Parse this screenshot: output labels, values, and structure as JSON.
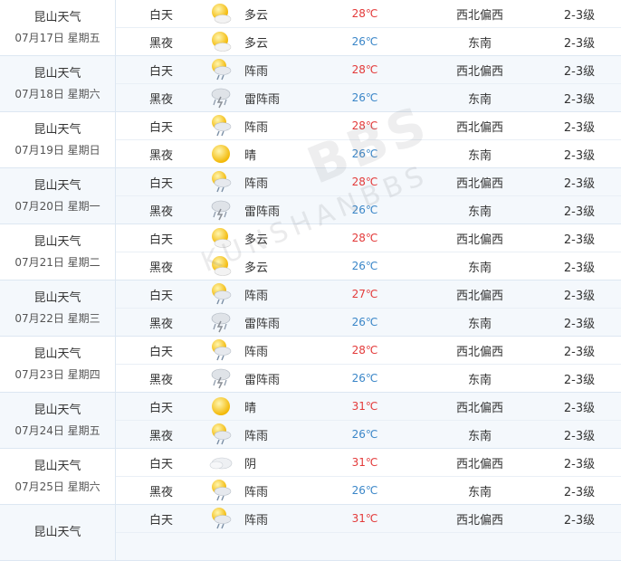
{
  "colors": {
    "hot": "#e33a3a",
    "mild": "#3a86c8",
    "row_alt": "#f4f8fc",
    "border": "#dde7f2"
  },
  "watermark": {
    "big": "BBS",
    "small": "KUNSHANBBS"
  },
  "days": [
    {
      "city": "昆山天气",
      "date": "07月17日 星期五",
      "day": {
        "period": "白天",
        "icon": "partly-cloudy-icon",
        "desc": "多云",
        "temp": "28℃",
        "wind": "西北偏西",
        "level": "2-3级"
      },
      "night": {
        "period": "黑夜",
        "icon": "partly-cloudy-icon",
        "desc": "多云",
        "temp": "26℃",
        "wind": "东南",
        "level": "2-3级"
      }
    },
    {
      "city": "昆山天气",
      "date": "07月18日 星期六",
      "day": {
        "period": "白天",
        "icon": "shower-icon",
        "desc": "阵雨",
        "temp": "28℃",
        "wind": "西北偏西",
        "level": "2-3级"
      },
      "night": {
        "period": "黑夜",
        "icon": "thunderstorm-icon",
        "desc": "雷阵雨",
        "temp": "26℃",
        "wind": "东南",
        "level": "2-3级"
      }
    },
    {
      "city": "昆山天气",
      "date": "07月19日 星期日",
      "day": {
        "period": "白天",
        "icon": "shower-icon",
        "desc": "阵雨",
        "temp": "28℃",
        "wind": "西北偏西",
        "level": "2-3级"
      },
      "night": {
        "period": "黑夜",
        "icon": "sun-icon",
        "desc": "晴",
        "temp": "26℃",
        "wind": "东南",
        "level": "2-3级"
      }
    },
    {
      "city": "昆山天气",
      "date": "07月20日 星期一",
      "day": {
        "period": "白天",
        "icon": "shower-icon",
        "desc": "阵雨",
        "temp": "28℃",
        "wind": "西北偏西",
        "level": "2-3级"
      },
      "night": {
        "period": "黑夜",
        "icon": "thunderstorm-icon",
        "desc": "雷阵雨",
        "temp": "26℃",
        "wind": "东南",
        "level": "2-3级"
      }
    },
    {
      "city": "昆山天气",
      "date": "07月21日 星期二",
      "day": {
        "period": "白天",
        "icon": "partly-cloudy-icon",
        "desc": "多云",
        "temp": "28℃",
        "wind": "西北偏西",
        "level": "2-3级"
      },
      "night": {
        "period": "黑夜",
        "icon": "partly-cloudy-icon",
        "desc": "多云",
        "temp": "26℃",
        "wind": "东南",
        "level": "2-3级"
      }
    },
    {
      "city": "昆山天气",
      "date": "07月22日 星期三",
      "day": {
        "period": "白天",
        "icon": "shower-icon",
        "desc": "阵雨",
        "temp": "27℃",
        "wind": "西北偏西",
        "level": "2-3级"
      },
      "night": {
        "period": "黑夜",
        "icon": "thunderstorm-icon",
        "desc": "雷阵雨",
        "temp": "26℃",
        "wind": "东南",
        "level": "2-3级"
      }
    },
    {
      "city": "昆山天气",
      "date": "07月23日 星期四",
      "day": {
        "period": "白天",
        "icon": "shower-icon",
        "desc": "阵雨",
        "temp": "28℃",
        "wind": "西北偏西",
        "level": "2-3级"
      },
      "night": {
        "period": "黑夜",
        "icon": "thunderstorm-icon",
        "desc": "雷阵雨",
        "temp": "26℃",
        "wind": "东南",
        "level": "2-3级"
      }
    },
    {
      "city": "昆山天气",
      "date": "07月24日 星期五",
      "day": {
        "period": "白天",
        "icon": "sun-icon",
        "desc": "晴",
        "temp": "31℃",
        "wind": "西北偏西",
        "level": "2-3级"
      },
      "night": {
        "period": "黑夜",
        "icon": "shower-icon",
        "desc": "阵雨",
        "temp": "26℃",
        "wind": "东南",
        "level": "2-3级"
      }
    },
    {
      "city": "昆山天气",
      "date": "07月25日 星期六",
      "day": {
        "period": "白天",
        "icon": "overcast-icon",
        "desc": "阴",
        "temp": "31℃",
        "wind": "西北偏西",
        "level": "2-3级"
      },
      "night": {
        "period": "黑夜",
        "icon": "shower-icon",
        "desc": "阵雨",
        "temp": "26℃",
        "wind": "东南",
        "level": "2-3级"
      }
    },
    {
      "city": "昆山天气",
      "date": "",
      "day": {
        "period": "白天",
        "icon": "shower-icon",
        "desc": "阵雨",
        "temp": "31℃",
        "wind": "西北偏西",
        "level": "2-3级"
      },
      "night": {
        "period": "",
        "icon": "",
        "desc": "",
        "temp": "",
        "wind": "",
        "level": ""
      }
    }
  ]
}
